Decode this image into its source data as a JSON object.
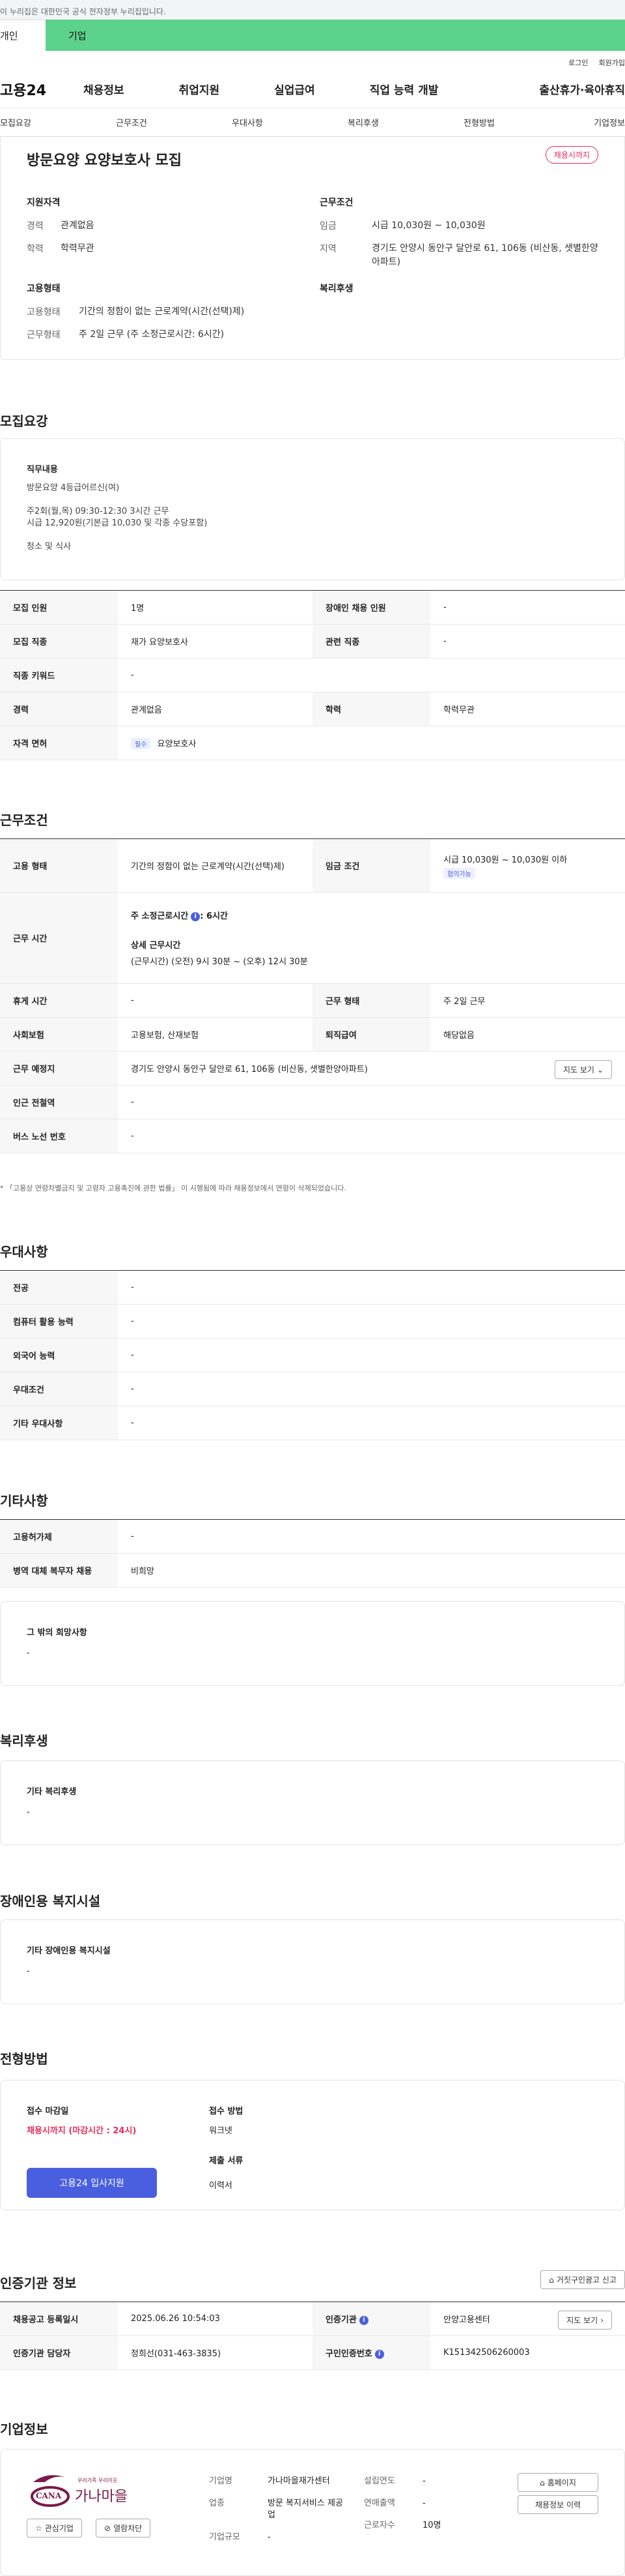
{
  "gov_bar": "이 누리집은 대한민국 공식 전자정부 누리집입니다.",
  "tabs": {
    "personal": "개인",
    "company": "기업"
  },
  "util": {
    "login": "로그인",
    "join": "회원가입"
  },
  "gnb": {
    "logo": "고용24",
    "items": [
      "채용정보",
      "취업지원",
      "실업급여",
      "직업 능력 개발",
      "출산휴가·육아휴직"
    ]
  },
  "anchor_nav": [
    "모집요강",
    "근무조건",
    "우대사항",
    "복리후생",
    "전형방법",
    "기업정보"
  ],
  "summary": {
    "title": "방문요양 요양보호사 모집",
    "deadline_badge": "채용시까지",
    "qual_head": "지원자격",
    "career_k": "경력",
    "career_v": "관계없음",
    "edu_k": "학력",
    "edu_v": "학력무관",
    "cond_head": "근무조건",
    "wage_k": "임금",
    "wage_v": "시급 10,030원 ~ 10,030원",
    "region_k": "지역",
    "region_v": "경기도 안양시 동안구 달안로 61, 106동 (비산동, 샛별한양아파트)",
    "emp_head": "고용형태",
    "emptype_k": "고용형태",
    "emptype_v": "기간의 정함이 없는 근로계약(시간(선택)제)",
    "worktype_k": "근무형태",
    "worktype_v": "주 2일 근무 (주 소정근로시간: 6시간)",
    "welfare_head": "복리후생"
  },
  "recruit": {
    "title": "모집요강",
    "duty_head": "직무내용",
    "duty_lines": [
      "방문요양 4등급어르신(여)",
      "",
      "주2회(월,목) 09:30-12:30 3시간 근무",
      "시급  12,920원(기본급 10,030 및 각종 수당포함)",
      "",
      "청소 및 식사"
    ],
    "table": {
      "headcount_h": "모집 인원",
      "headcount_v": "1명",
      "disabled_h": "장애인 채용 인원",
      "disabled_v": "-",
      "job_h": "모집 직종",
      "job_v": "재가 요양보호사",
      "related_h": "관련 직종",
      "related_v": "-",
      "keyword_h": "직종 키워드",
      "keyword_v": "-",
      "career_h": "경력",
      "career_v": "관계없음",
      "edu_h": "학력",
      "edu_v": "학력무관",
      "license_h": "자격 면허",
      "license_tag": "필수",
      "license_v": "요양보호사"
    }
  },
  "conditions": {
    "title": "근무조건",
    "emptype_h": "고용 형태",
    "emptype_v": "기간의 정함이 없는 근로계약(시간(선택)제)",
    "wage_h": "임금 조건",
    "wage_v": "시급 10,030원 ~ 10,030원 이하",
    "wage_badge": "협의가능",
    "hours_h": "근무 시간",
    "hours_weekly": "주 소정근로시간",
    "hours_weekly_v": ": 6시간",
    "hours_detail_head": "상세 근무시간",
    "hours_detail_v": "(근무시간) (오전) 9시 30분 ~ (오후) 12시 30분",
    "break_h": "휴게 시간",
    "break_v": "-",
    "worktype_h": "근무 형태",
    "worktype_v": "주 2일 근무",
    "insurance_h": "사회보험",
    "insurance_v": "고용보험, 산재보험",
    "severance_h": "퇴직급여",
    "severance_v": "해당없음",
    "location_h": "근무 예정지",
    "location_v": "경기도 안양시 동안구 달안로 61, 106동 (비산동, 샛별한양아파트)",
    "map_btn": "지도 보기",
    "subway_h": "인근 전철역",
    "subway_v": "-",
    "bus_h": "버스 노선 번호",
    "bus_v": "-",
    "note": "* 「고용상 연령차별금지 및 고령자 고용촉진에 관한 법률」 이 시행됨에 따라 채용정보에서 연령이 삭제되었습니다."
  },
  "preferences": {
    "title": "우대사항",
    "major_h": "전공",
    "major_v": "-",
    "computer_h": "컴퓨터 활용 능력",
    "computer_v": "-",
    "language_h": "외국어 능력",
    "language_v": "-",
    "pref_h": "우대조건",
    "pref_v": "-",
    "other_h": "기타 우대사항",
    "other_v": "-"
  },
  "etc": {
    "title": "기타사항",
    "subsidy_h": "고용허가제",
    "subsidy_v": "-",
    "military_h": "병역 대체 복무자 채용",
    "military_v": "비희망",
    "wish_head": "그 밖의 희망사항",
    "wish_v": "-"
  },
  "welfare": {
    "title": "복리후생",
    "head": "기타 복리후생",
    "v": "-"
  },
  "disability": {
    "title": "장애인용 복지시설",
    "head": "기타 장애인용 복지시설",
    "v": "-"
  },
  "selection": {
    "title": "전형방법",
    "deadline_head": "접수 마감일",
    "deadline_v": "채용시까지 (마감시간 : 24시)",
    "method_head": "접수 방법",
    "method_v": "워크넷",
    "docs_head": "제출 서류",
    "docs_v": "이력서",
    "apply_btn": "고용24 입사지원"
  },
  "agency": {
    "title": "인증기관 정보",
    "report_btn": "거짓구인광고 신고",
    "regdate_h": "채용공고 등록일시",
    "regdate_v": "2025.06.26 10:54:03",
    "agency_h": "인증기관",
    "agency_v": "안양고용센터",
    "map_btn": "지도 보기",
    "manager_h": "인증기관 담당자",
    "manager_v": "정희선(031-463-3835)",
    "certno_h": "구인인증번호",
    "certno_v": "K151342506260003"
  },
  "company": {
    "title": "기업정보",
    "logo_small": "우리가족 우리이웃",
    "logo_text": "가나마을",
    "logo_en": "CANA",
    "like_btn": "관심기업",
    "block_btn": "열람차단",
    "name_k": "기업명",
    "name_v": "가나마을재가센터",
    "industry_k": "업종",
    "industry_v": "방문 복지서비스 제공업",
    "size_k": "기업규모",
    "size_v": "-",
    "founded_k": "설립연도",
    "founded_v": "-",
    "revenue_k": "연매출액",
    "revenue_v": "-",
    "employees_k": "근로자수",
    "employees_v": "10명",
    "homepage_btn": "홈페이지",
    "history_btn": "채용정보 이력"
  }
}
